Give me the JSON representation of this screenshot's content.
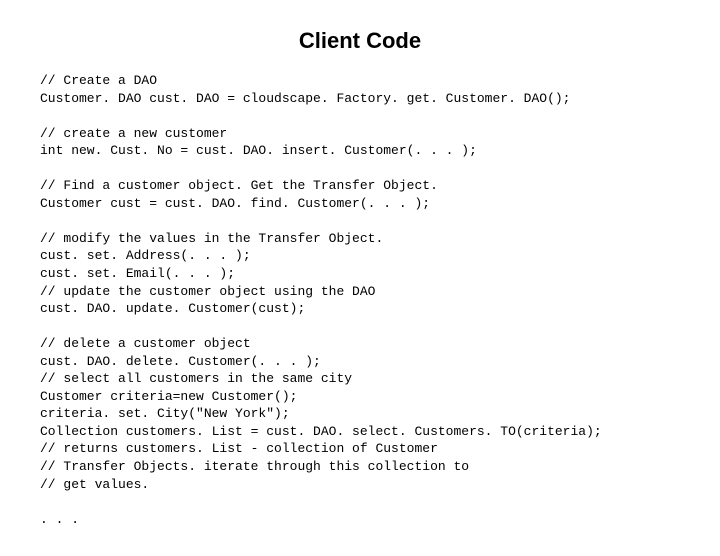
{
  "title": "Client Code",
  "code_lines": [
    "// Create a DAO",
    "Customer. DAO cust. DAO = cloudscape. Factory. get. Customer. DAO();",
    "",
    "// create a new customer",
    "int new. Cust. No = cust. DAO. insert. Customer(. . . );",
    "",
    "// Find a customer object. Get the Transfer Object.",
    "Customer cust = cust. DAO. find. Customer(. . . );",
    "",
    "// modify the values in the Transfer Object.",
    "cust. set. Address(. . . );",
    "cust. set. Email(. . . );",
    "// update the customer object using the DAO",
    "cust. DAO. update. Customer(cust);",
    "",
    "// delete a customer object",
    "cust. DAO. delete. Customer(. . . );",
    "// select all customers in the same city",
    "Customer criteria=new Customer();",
    "criteria. set. City(\"New York\");",
    "Collection customers. List = cust. DAO. select. Customers. TO(criteria);",
    "// returns customers. List - collection of Customer",
    "// Transfer Objects. iterate through this collection to",
    "// get values.",
    "",
    ". . ."
  ]
}
